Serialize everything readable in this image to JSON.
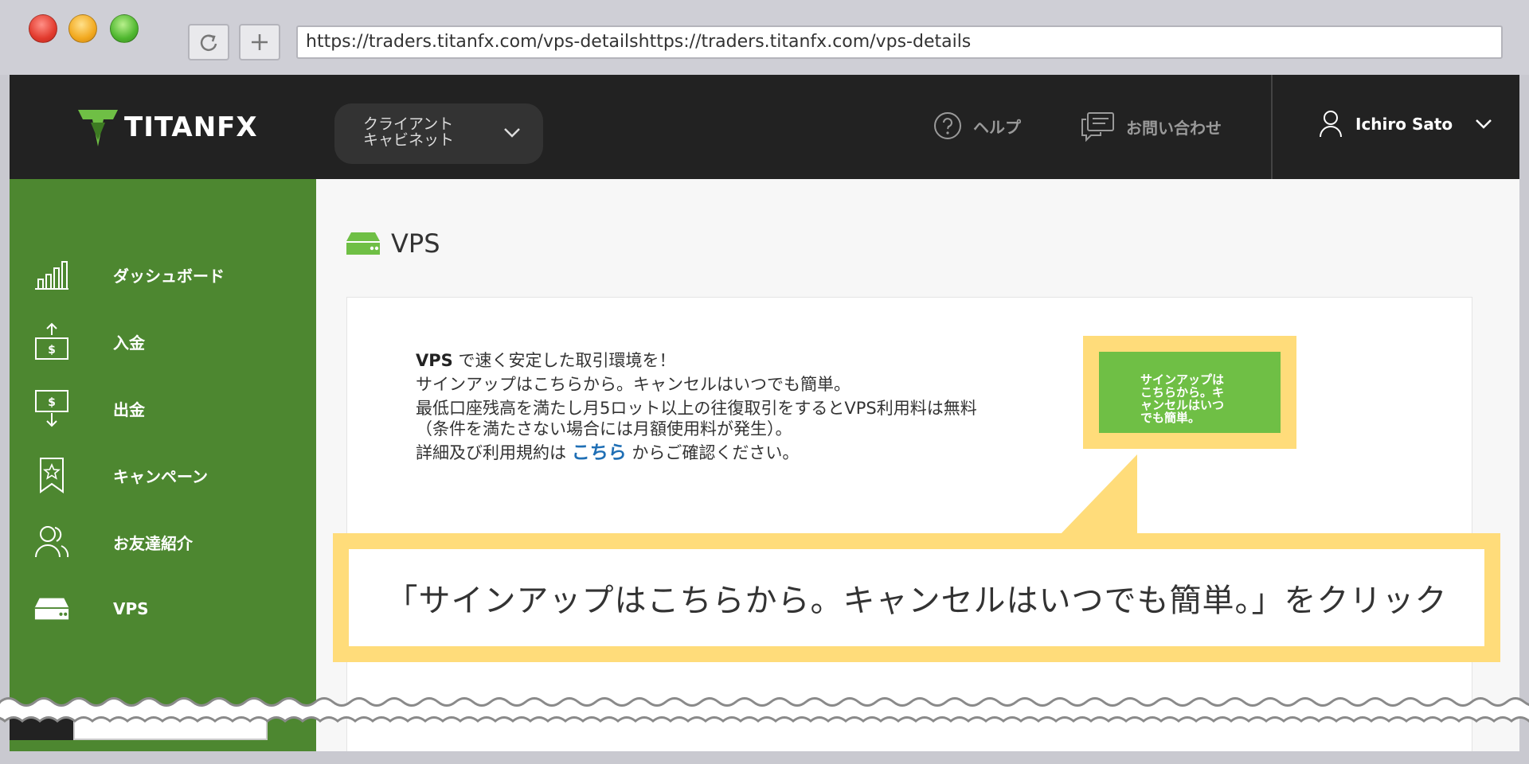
{
  "browser": {
    "url": "https://traders.titanfx.com/vps-detailshttps://traders.titanfx.com/vps-details",
    "reload_icon": "reload-icon",
    "newtab_icon": "plus-icon"
  },
  "header": {
    "logo_text": "TITANFX",
    "portal_line1": "クライアント",
    "portal_line2": "キャビネット",
    "help_label": "ヘルプ",
    "contact_label": "お問い合わせ",
    "user_name": "Ichiro Sato"
  },
  "sidebar": {
    "items": [
      {
        "label": "ダッシュボード",
        "icon": "bar-chart-icon"
      },
      {
        "label": "入金",
        "icon": "deposit-icon"
      },
      {
        "label": "出金",
        "icon": "withdraw-icon"
      },
      {
        "label": "キャンペーン",
        "icon": "bookmark-star-icon"
      },
      {
        "label": "お友達紹介",
        "icon": "users-icon"
      },
      {
        "label": "VPS",
        "icon": "server-icon"
      }
    ]
  },
  "main": {
    "page_title": "VPS",
    "desc": {
      "line1_bold": "VPS",
      "line1_rest": " で速く安定した取引環境を！",
      "line2": "サインアップはこちらから。キャンセルはいつでも簡単。",
      "line3": "最低口座残高を満たし月5ロット以上の往復取引をするとVPS利用料は無料",
      "line4": "（条件を満たさない場合には月額使用料が発生）。",
      "line5_pre": "詳細及び利用規約は ",
      "line5_link": "こちら",
      "line5_post": " からご確認ください。"
    },
    "signup_button": {
      "line1": "サインアップは",
      "line2": "こちらから。キ",
      "line3": "ャンセルはいつ",
      "line4": "でも簡単。"
    }
  },
  "callout": {
    "text": "「サインアップはこちらから。キャンセルはいつでも簡単。」をクリック"
  },
  "colors": {
    "header_bg": "#222222",
    "sidebar_bg": "#4d8730",
    "accent_green": "#6fbf45",
    "highlight_yellow": "#ffdc7a",
    "link_blue": "#1f6fb5"
  }
}
